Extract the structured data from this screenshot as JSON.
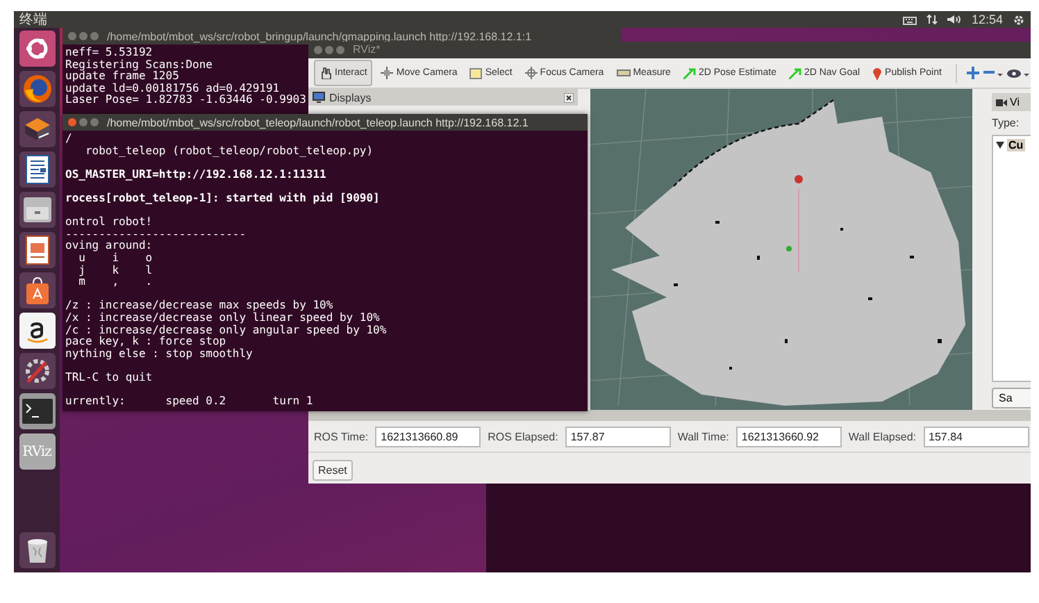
{
  "top_bar": {
    "title": "终端",
    "clock": "12:54"
  },
  "launcher": {
    "rviz_label": "RViz"
  },
  "gmapping_terminal": {
    "title": "/home/mbot/mbot_ws/src/robot_bringup/launch/gmapping.launch http://192.168.12.1:1",
    "focused": false,
    "lines": [
      {
        "text": "neff= 5.53192",
        "bold": false,
        "space_before": false
      },
      {
        "text": "Registering Scans:Done",
        "bold": false,
        "space_before": false
      },
      {
        "text": "update frame 1205",
        "bold": false,
        "space_before": false
      },
      {
        "text": "update ld=0.00181756 ad=0.429191",
        "bold": false,
        "space_before": false
      },
      {
        "text": "Laser Pose= 1.82783 -1.63446 -0.9903",
        "bold": false,
        "space_before": false
      }
    ]
  },
  "rviz": {
    "title": "RViz*",
    "tools": [
      {
        "label": "Interact",
        "kind": "hand",
        "selected": true
      },
      {
        "label": "Move Camera",
        "kind": "move",
        "selected": false
      },
      {
        "label": "Select",
        "kind": "select",
        "selected": false
      },
      {
        "label": "Focus Camera",
        "kind": "focus",
        "selected": false
      },
      {
        "label": "Measure",
        "kind": "ruler",
        "selected": false
      },
      {
        "label": "2D Pose Estimate",
        "kind": "arrow",
        "selected": false
      },
      {
        "label": "2D Nav Goal",
        "kind": "arrow",
        "selected": false
      },
      {
        "label": "Publish Point",
        "kind": "pin",
        "selected": false
      }
    ],
    "displays_panel": {
      "title": "Displays"
    },
    "views_panel": {
      "title": "Vi",
      "type_label": "Type:",
      "tree_item": "Cu",
      "button": "Sa"
    },
    "time_bar": {
      "fields": [
        {
          "label": "ROS Time:",
          "value": "1621313660.89"
        },
        {
          "label": "ROS Elapsed:",
          "value": "157.87"
        },
        {
          "label": "Wall Time:",
          "value": "1621313660.92"
        },
        {
          "label": "Wall Elapsed:",
          "value": "157.84"
        }
      ],
      "reset": "Reset"
    }
  },
  "teleop_terminal": {
    "title": "/home/mbot/mbot_ws/src/robot_teleop/launch/robot_teleop.launch http://192.168.12.1",
    "focused": true,
    "lines": [
      {
        "text": "/",
        "bold": false,
        "space_before": false
      },
      {
        "text": "   robot_teleop (robot_teleop/robot_teleop.py)",
        "bold": false,
        "space_before": false
      },
      {
        "text": "OS_MASTER_URI=http://192.168.12.1:11311",
        "bold": true,
        "space_before": true
      },
      {
        "text": "rocess[robot_teleop-1]: started with pid [9090]",
        "bold": true,
        "space_before": true
      },
      {
        "text": "ontrol robot!",
        "bold": false,
        "space_before": true
      },
      {
        "text": "---------------------------",
        "bold": false,
        "space_before": false
      },
      {
        "text": "oving around:",
        "bold": false,
        "space_before": false
      },
      {
        "text": "  u    i    o",
        "bold": false,
        "space_before": false
      },
      {
        "text": "  j    k    l",
        "bold": false,
        "space_before": false
      },
      {
        "text": "  m    ,    .",
        "bold": false,
        "space_before": false
      },
      {
        "text": "/z : increase/decrease max speeds by 10%",
        "bold": false,
        "space_before": true
      },
      {
        "text": "/x : increase/decrease only linear speed by 10%",
        "bold": false,
        "space_before": false
      },
      {
        "text": "/c : increase/decrease only angular speed by 10%",
        "bold": false,
        "space_before": false
      },
      {
        "text": "pace key, k : force stop",
        "bold": false,
        "space_before": false
      },
      {
        "text": "nything else : stop smoothly",
        "bold": false,
        "space_before": false
      },
      {
        "text": "TRL-C to quit",
        "bold": false,
        "space_before": true
      },
      {
        "text": "urrently:      speed 0.2       turn 1",
        "bold": false,
        "space_before": true
      }
    ]
  }
}
